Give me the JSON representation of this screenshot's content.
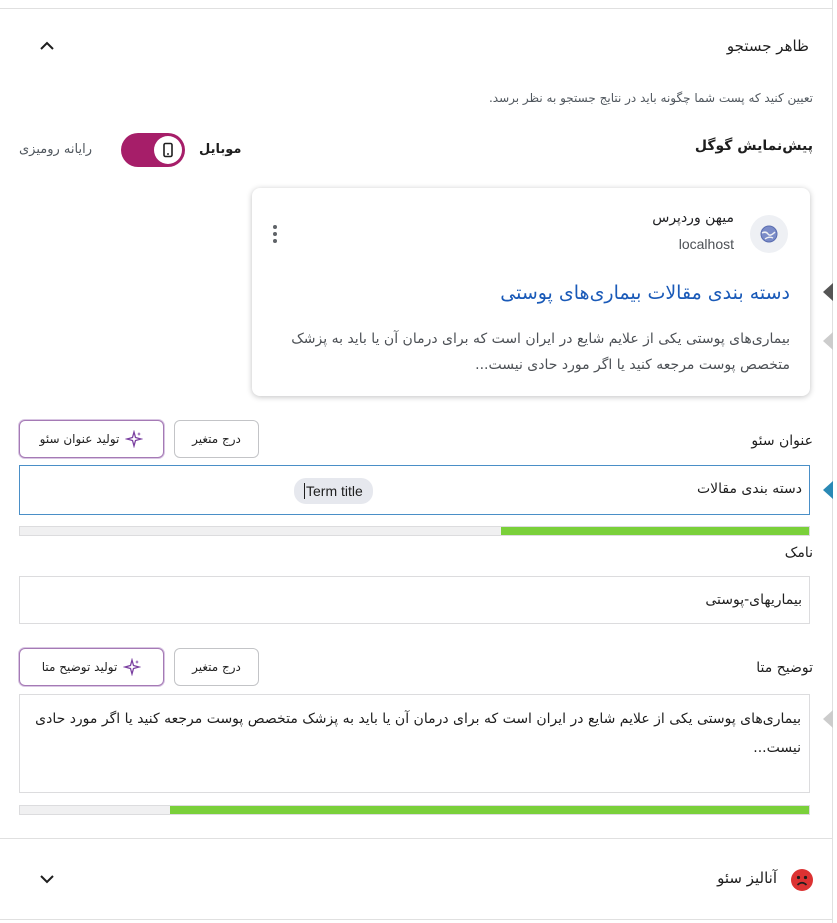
{
  "search_appearance": {
    "title": "ظاهر جستجو",
    "description": "تعیین کنید که پست شما چگونه باید در نتایج جستجو به نظر برسد."
  },
  "google_preview": {
    "label": "پیش‌نمایش گوگل",
    "mode_mobile": "موبایل",
    "mode_desktop": "رایانه رومیزی",
    "mobile_selected": true
  },
  "serp_card": {
    "site_name": "میهن وردپرس",
    "site_url": "localhost",
    "title": "دسته بندی مقالات بیماری‌های پوستی",
    "description": "بیماری‌های پوستی یکی از علایم شایع در ایران است که برای درمان آن یا باید به پزشک متخصص پوست مرجعه کنید یا اگر مورد حادی نیست..."
  },
  "seo_title": {
    "label": "عنوان سئو",
    "insert_variable": "درج متغیر",
    "generate": "تولید عنوان سئو",
    "text": "دسته بندی مقالات",
    "variable_tag": "Term title",
    "progress": 0.39
  },
  "slug": {
    "label": "نامک",
    "value": "بیماریهای-پوستی"
  },
  "meta_description": {
    "label": "توضیح متا",
    "insert_variable": "درج متغیر",
    "generate": "تولید توضیح متا",
    "value": "بیماری‌های پوستی یکی از علایم شایع در ایران است که برای درمان آن یا باید به پزشک متخصص پوست مرجعه کنید یا اگر مورد حادی نیست...",
    "progress": 0.81
  },
  "seo_analysis": {
    "title": "آنالیز سئو",
    "status_icon": "sad-face-icon",
    "status_color": "#dc3232"
  },
  "colors": {
    "accent": "#a61e69",
    "link": "#1a5ab8",
    "good": "#7ad03a"
  }
}
